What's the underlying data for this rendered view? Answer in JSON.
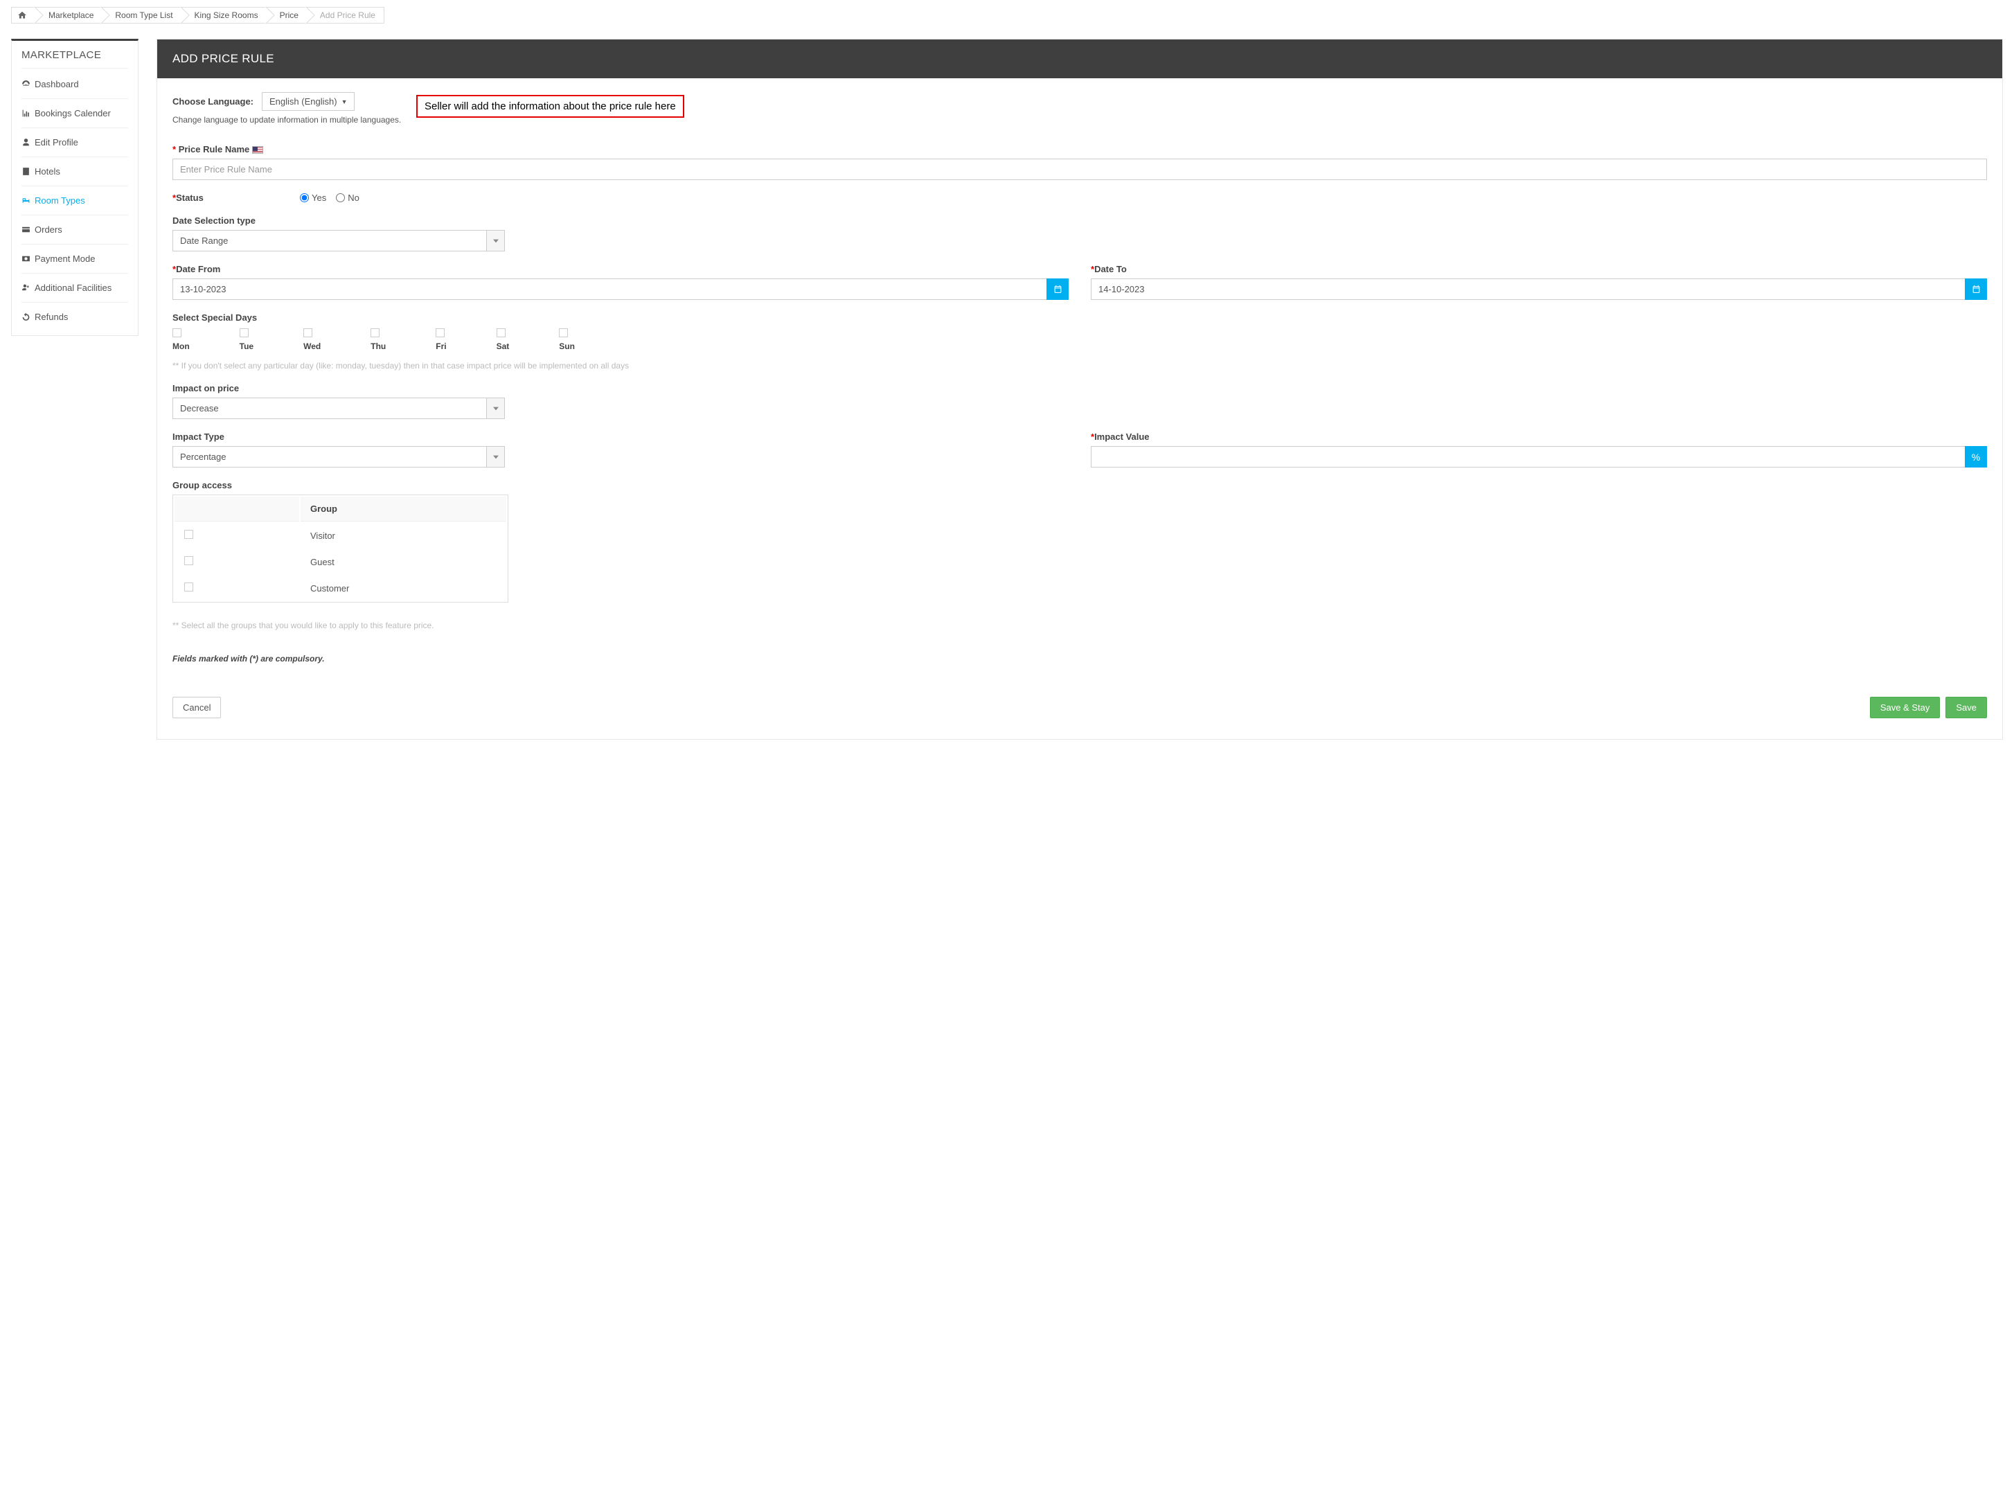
{
  "breadcrumb": {
    "items": [
      "Marketplace",
      "Room Type List",
      "King Size Rooms",
      "Price",
      "Add Price Rule"
    ]
  },
  "sidebar": {
    "title": "MARKETPLACE",
    "items": [
      {
        "label": "Dashboard"
      },
      {
        "label": "Bookings Calender"
      },
      {
        "label": "Edit Profile"
      },
      {
        "label": "Hotels"
      },
      {
        "label": "Room Types"
      },
      {
        "label": "Orders"
      },
      {
        "label": "Payment Mode"
      },
      {
        "label": "Additional Facilities"
      },
      {
        "label": "Refunds"
      }
    ]
  },
  "header": {
    "title": "ADD PRICE RULE"
  },
  "language": {
    "label": "Choose Language:",
    "value": "English (English)",
    "help": "Change language to update information in multiple languages."
  },
  "callout": {
    "text": "Seller will add the information about the price rule here"
  },
  "form": {
    "price_rule_name": {
      "label": "Price Rule Name",
      "placeholder": "Enter Price Rule Name"
    },
    "status": {
      "label": "Status",
      "yes": "Yes",
      "no": "No"
    },
    "date_selection": {
      "label": "Date Selection type",
      "value": "Date Range"
    },
    "date_from": {
      "label": "Date From",
      "value": "13-10-2023"
    },
    "date_to": {
      "label": "Date To",
      "value": "14-10-2023"
    },
    "special_days": {
      "label": "Select Special Days",
      "days": [
        "Mon",
        "Tue",
        "Wed",
        "Thu",
        "Fri",
        "Sat",
        "Sun"
      ],
      "help": "** If you don't select any particular day (like: monday, tuesday) then in that case impact price will be implemented on all days"
    },
    "impact_price": {
      "label": "Impact on price",
      "value": "Decrease"
    },
    "impact_type": {
      "label": "Impact Type",
      "value": "Percentage"
    },
    "impact_value": {
      "label": "Impact Value",
      "unit": "%"
    },
    "group_access": {
      "label": "Group access",
      "header": "Group",
      "rows": [
        "Visitor",
        "Guest",
        "Customer"
      ],
      "help": "** Select all the groups that you would like to apply to this feature price."
    },
    "compulsory": "Fields marked with (*) are compulsory."
  },
  "buttons": {
    "cancel": "Cancel",
    "save_stay": "Save & Stay",
    "save": "Save"
  }
}
